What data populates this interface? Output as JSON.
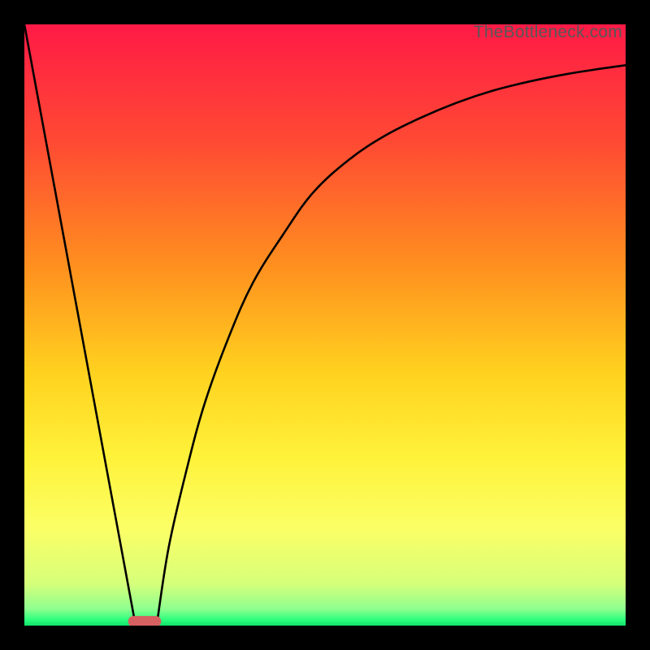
{
  "watermark": "TheBottleneck.com",
  "chart_data": {
    "type": "line",
    "title": "",
    "xlabel": "",
    "ylabel": "",
    "xlim": [
      0,
      100
    ],
    "ylim": [
      0,
      100
    ],
    "grid": false,
    "legend": false,
    "background_gradient_stops": [
      {
        "offset": 0,
        "color": "#ff1a46"
      },
      {
        "offset": 0.2,
        "color": "#ff4b33"
      },
      {
        "offset": 0.4,
        "color": "#ff8f1f"
      },
      {
        "offset": 0.58,
        "color": "#ffd21f"
      },
      {
        "offset": 0.72,
        "color": "#fff23a"
      },
      {
        "offset": 0.84,
        "color": "#fbff66"
      },
      {
        "offset": 0.93,
        "color": "#d6ff7a"
      },
      {
        "offset": 0.972,
        "color": "#8fff8f"
      },
      {
        "offset": 0.99,
        "color": "#2eff7d"
      },
      {
        "offset": 1.0,
        "color": "#0fe26a"
      }
    ],
    "series": [
      {
        "name": "descending-line",
        "x": [
          0,
          18.5
        ],
        "y": [
          100,
          0
        ]
      },
      {
        "name": "ascending-curve",
        "x": [
          22,
          24,
          27,
          30,
          34,
          38,
          43,
          48,
          54,
          60,
          66,
          72,
          78,
          84,
          90,
          95,
          100
        ],
        "y": [
          0,
          13,
          26,
          37,
          48,
          57,
          65,
          72,
          77.5,
          81.5,
          84.5,
          87,
          89,
          90.5,
          91.7,
          92.5,
          93.2
        ]
      }
    ],
    "bottom_marker": {
      "name": "bottom-pill",
      "x_center": 20,
      "width": 5.5,
      "y": 0,
      "color": "#d76060"
    }
  }
}
